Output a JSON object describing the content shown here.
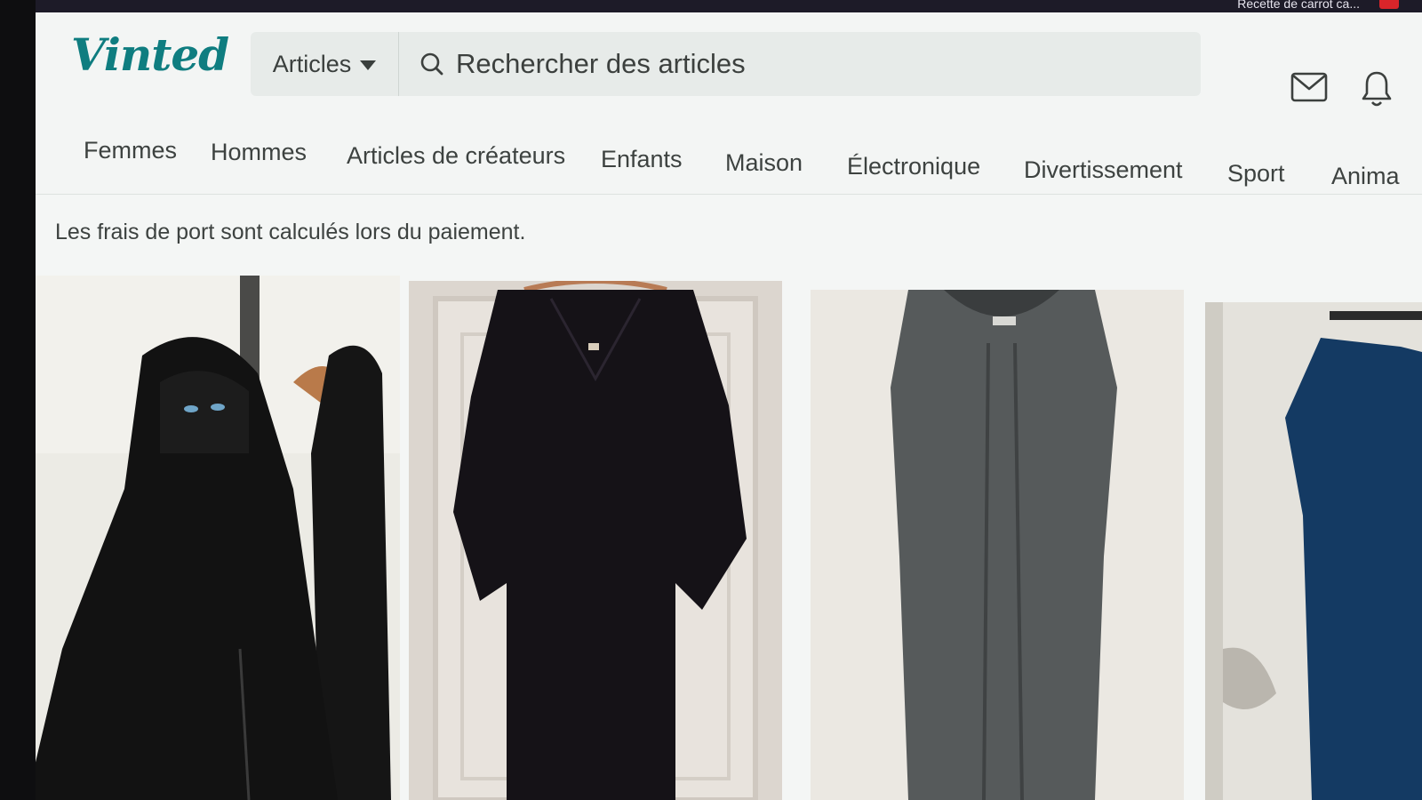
{
  "browser": {
    "tab_snippet": "Recette de carrot ca..."
  },
  "header": {
    "logo": "Vinted",
    "category_select": "Articles",
    "search_placeholder": "Rechercher des articles",
    "icons": [
      "mail-icon",
      "bell-icon",
      "search-icon",
      "chevron-down-icon"
    ]
  },
  "nav": {
    "items": [
      "Femmes",
      "Hommes",
      "Articles de créateurs",
      "Enfants",
      "Maison",
      "Électronique",
      "Divertissement",
      "Sport",
      "Anima"
    ]
  },
  "notice": "Les frais de port sont calculés lors du paiement.",
  "products": [
    {
      "kind": "black abaya with niqab"
    },
    {
      "kind": "black dress on hanger"
    },
    {
      "kind": "grey sleeveless dress"
    },
    {
      "kind": "navy dress on rack"
    }
  ],
  "colors": {
    "brand": "#0f7d80",
    "text": "#3d4240",
    "background": "#f3f5f4"
  }
}
